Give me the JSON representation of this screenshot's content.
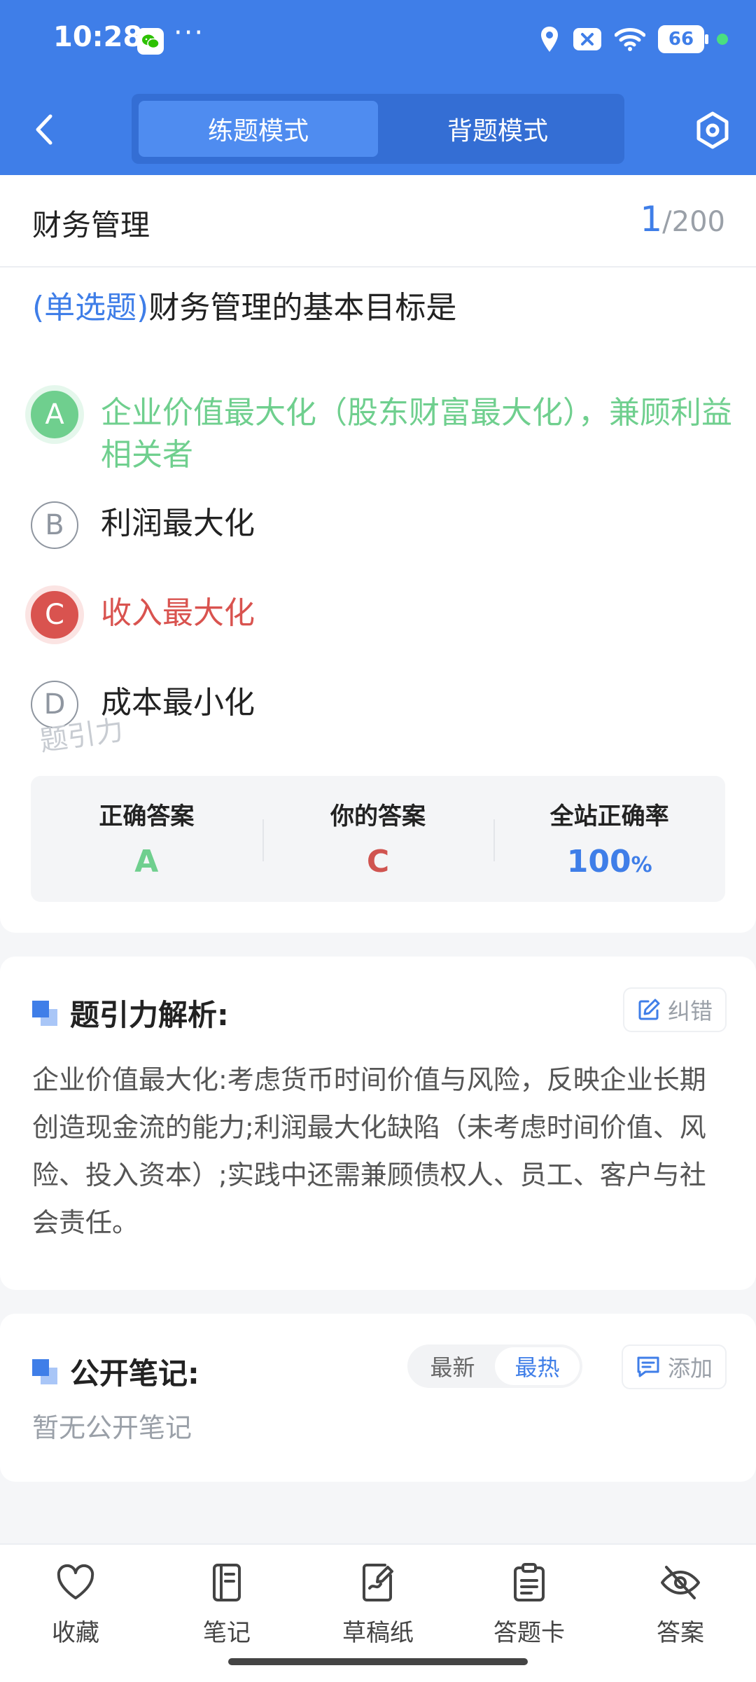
{
  "status": {
    "time": "10:28",
    "more": "···",
    "battery": "66"
  },
  "nav": {
    "tabs": [
      "练题模式",
      "背题模式"
    ],
    "active_tab": 0
  },
  "question": {
    "subject": "财务管理",
    "current": "1",
    "total": "/200",
    "type": "(单选题)",
    "text": "财务管理的基本目标是",
    "options": [
      {
        "letter": "A",
        "text": "企业价值最大化（股东财富最大化），兼顾利益相关者",
        "state": "correct"
      },
      {
        "letter": "B",
        "text": "利润最大化",
        "state": "normal"
      },
      {
        "letter": "C",
        "text": "收入最大化",
        "state": "wrong"
      },
      {
        "letter": "D",
        "text": "成本最小化",
        "state": "normal"
      }
    ]
  },
  "answer": {
    "correct_label": "正确答案",
    "correct_value": "A",
    "yours_label": "你的答案",
    "yours_value": "C",
    "rate_label": "全站正确率",
    "rate_value": "100",
    "rate_unit": "%"
  },
  "watermark": "题引力",
  "analysis": {
    "title": "题引力解析:",
    "report_label": "纠错",
    "text": "企业价值最大化:考虑货币时间价值与风险，反映企业长期创造现金流的能力;利润最大化缺陷（未考虑时间价值、风险、投入资本）;实践中还需兼顾债权人、员工、客户与社会责任。"
  },
  "notes": {
    "title": "公开笔记:",
    "sort_options": [
      "最新",
      "最热"
    ],
    "active_sort": 1,
    "add_label": "添加",
    "empty_text": "暂无公开笔记"
  },
  "bottom_bar": [
    {
      "label": "收藏",
      "icon": "heart-icon"
    },
    {
      "label": "笔记",
      "icon": "notebook-icon"
    },
    {
      "label": "草稿纸",
      "icon": "draft-icon"
    },
    {
      "label": "答题卡",
      "icon": "clipboard-icon"
    },
    {
      "label": "答案",
      "icon": "eye-off-icon"
    }
  ],
  "colors": {
    "primary": "#3f7ee8",
    "correct": "#6fcf8e",
    "wrong": "#d9534f"
  }
}
